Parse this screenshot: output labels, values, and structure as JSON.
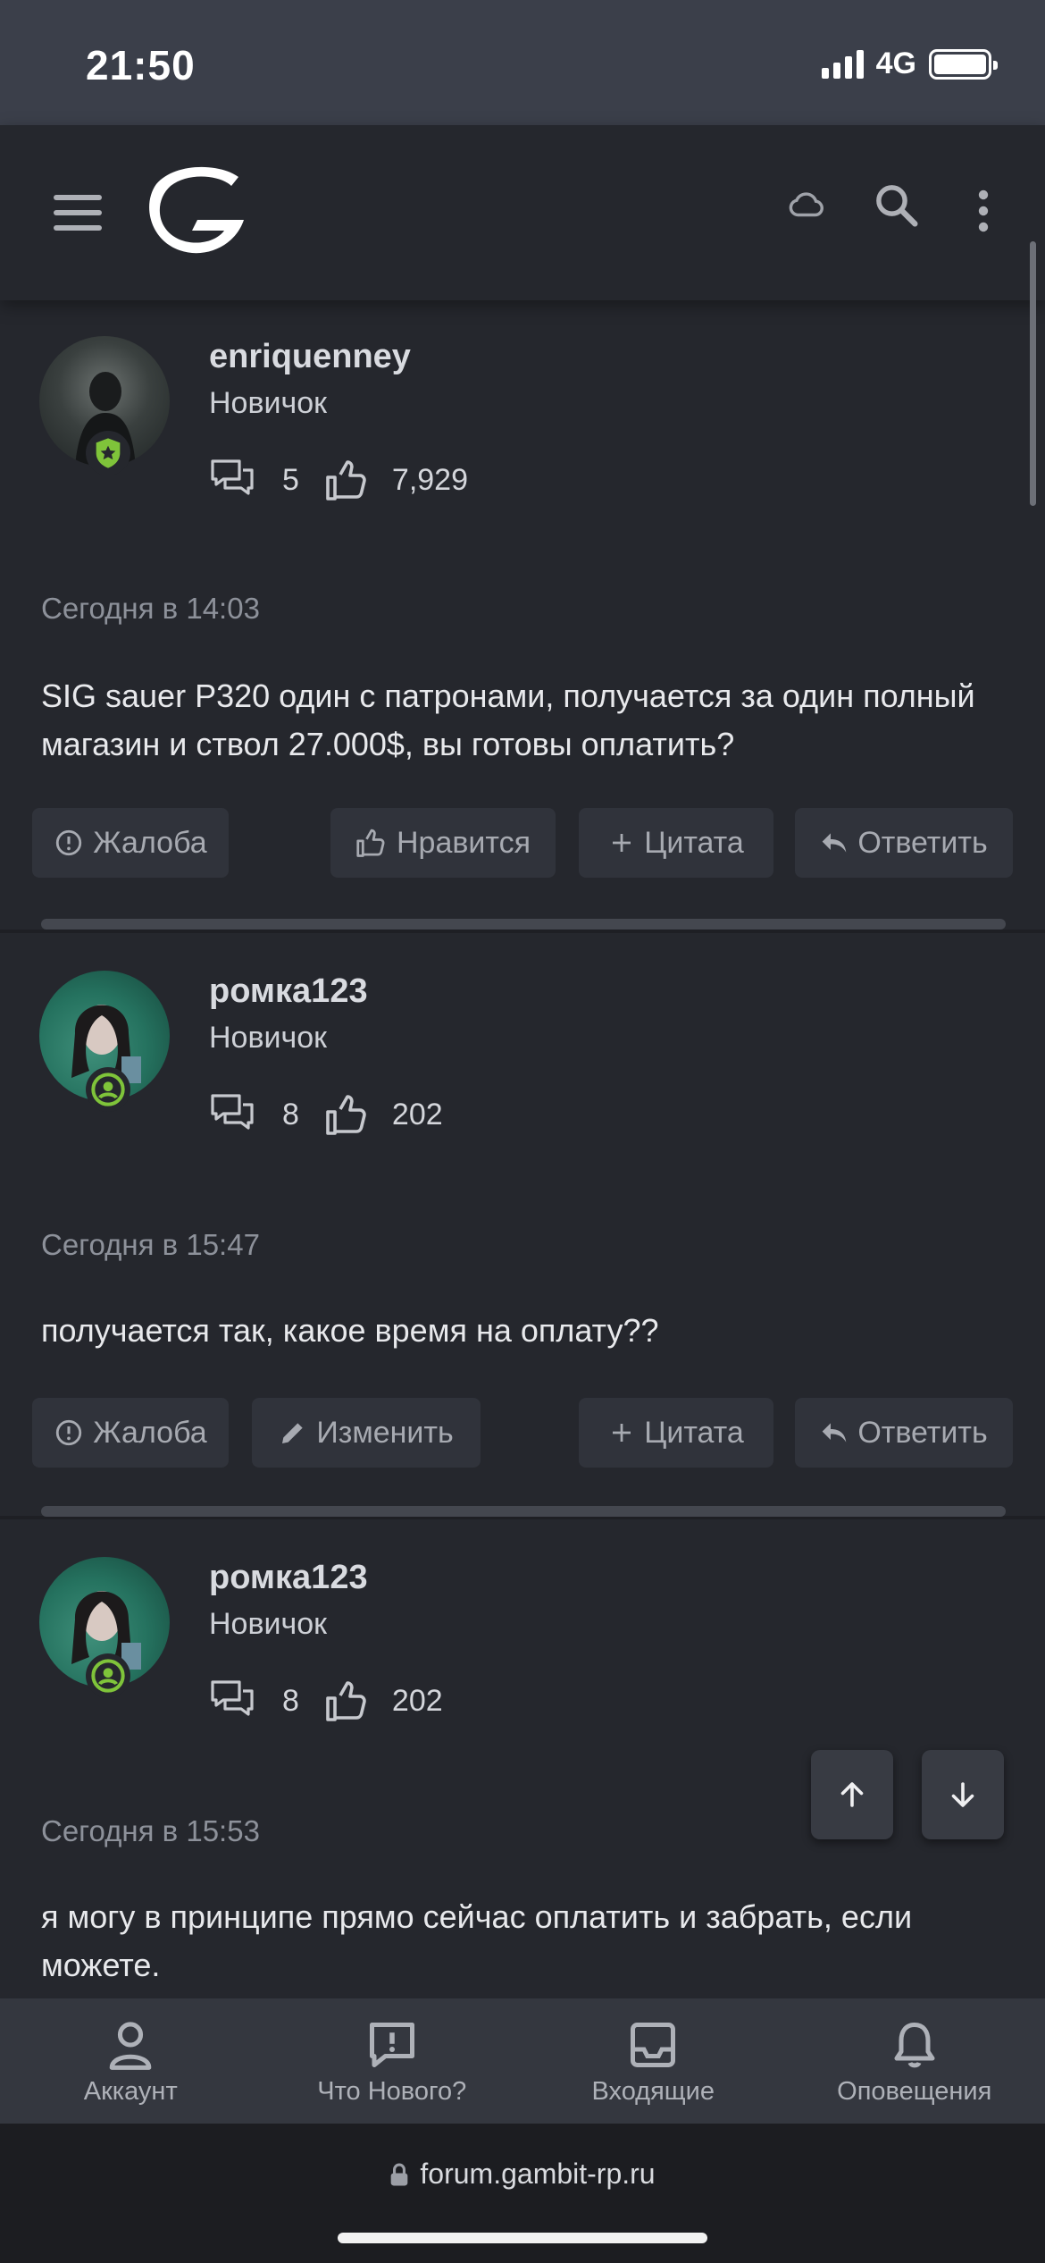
{
  "status": {
    "time": "21:50",
    "network": "4G"
  },
  "header": {
    "menu_icon": "hamburger-icon",
    "logo_icon": "gambit-logo",
    "icons": [
      "cloud-icon",
      "search-icon",
      "more-vertical-icon"
    ]
  },
  "posts": [
    {
      "username": "enriquenney",
      "role": "Новичок",
      "messages": "5",
      "likes": "7,929",
      "time": "Сегодня в 14:03",
      "text": "SIG sauer P320 один с патронами, получается за один полный магазин и ствол 27.000$, вы готовы оплатить?",
      "actions": {
        "report": "Жалоба",
        "like": "Нравится",
        "quote": "Цитата",
        "reply": "Ответить"
      }
    },
    {
      "username": "ромка123",
      "role": "Новичок",
      "messages": "8",
      "likes": "202",
      "time": "Сегодня в 15:47",
      "text": "получается так, какое время на оплату??",
      "actions": {
        "report": "Жалоба",
        "edit": "Изменить",
        "quote": "Цитата",
        "reply": "Ответить"
      }
    },
    {
      "username": "ромка123",
      "role": "Новичок",
      "messages": "8",
      "likes": "202",
      "time": "Сегодня в 15:53",
      "text": "я могу в принципе прямо сейчас оплатить и забрать, если можете."
    }
  ],
  "tabs": [
    {
      "label": "Аккаунт",
      "icon": "user-icon"
    },
    {
      "label": "Что Нового?",
      "icon": "whats-new-icon"
    },
    {
      "label": "Входящие",
      "icon": "inbox-icon"
    },
    {
      "label": "Оповещения",
      "icon": "bell-icon"
    }
  ],
  "browser": {
    "url": "forum.gambit-rp.ru"
  },
  "colors": {
    "background": "#1e1f24",
    "card": "#25272d",
    "button": "#30333b",
    "badge_green": "#7fc43a"
  }
}
